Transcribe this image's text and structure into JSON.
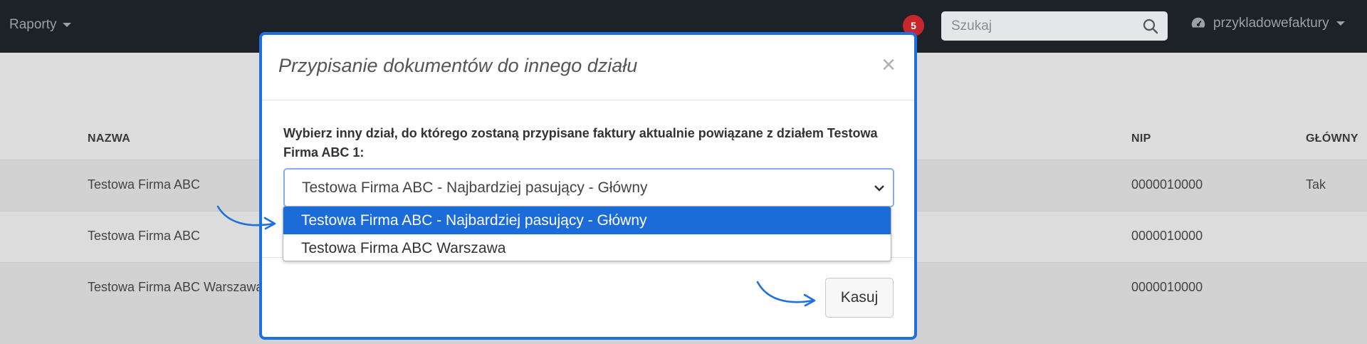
{
  "navbar": {
    "reports_label": "Raporty",
    "notification_count": "5",
    "search_placeholder": "Szukaj",
    "account_label": "przykladowefaktury"
  },
  "table": {
    "headers": {
      "name": "NAZWA",
      "nip": "NIP",
      "main": "GŁÓWNY"
    },
    "rows": [
      {
        "name": "Testowa Firma ABC",
        "nip": "0000010000",
        "main": "Tak"
      },
      {
        "name": "Testowa Firma ABC",
        "nip": "0000010000",
        "main": ""
      },
      {
        "name": "Testowa Firma ABC Warszawa",
        "nip": "0000010000",
        "main": ""
      }
    ]
  },
  "modal": {
    "title": "Przypisanie dokumentów do innego działu",
    "close_symbol": "×",
    "instruction": "Wybierz inny dział, do którego zostaną przypisane faktury aktualnie powiązane z działem Testowa Firma ABC 1:",
    "select_value": "Testowa Firma ABC - Najbardziej pasujący - Główny",
    "options": [
      {
        "label": "Testowa Firma ABC - Najbardziej pasujący - Główny",
        "selected": true
      },
      {
        "label": "Testowa Firma ABC Warszawa",
        "selected": false
      }
    ],
    "cancel_label": "Kasuj"
  },
  "colors": {
    "navbar_bg": "#1d2228",
    "modal_border": "#1e6fe0",
    "option_selected": "#1b6bd8",
    "badge": "#c8262d"
  }
}
